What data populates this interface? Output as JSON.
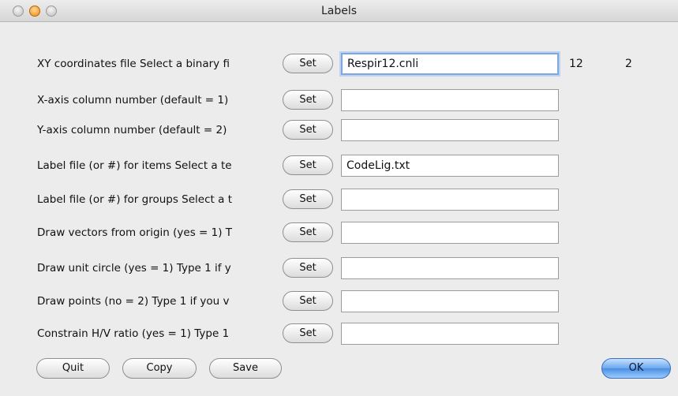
{
  "window": {
    "title": "Labels"
  },
  "rows": [
    {
      "label": "XY coordinates file Select a binary fi",
      "button": "Set",
      "value": "Respir12.cnli",
      "extra": [
        "12",
        "2"
      ]
    },
    {
      "label": "X-axis column number (default = 1)",
      "button": "Set",
      "value": ""
    },
    {
      "label": "Y-axis column number (default = 2)",
      "button": "Set",
      "value": ""
    },
    {
      "label": "Label file (or #) for items Select a te",
      "button": "Set",
      "value": "CodeLig.txt"
    },
    {
      "label": "Label file (or #) for groups Select a t",
      "button": "Set",
      "value": ""
    },
    {
      "label": "Draw vectors from origin (yes = 1) T",
      "button": "Set",
      "value": ""
    },
    {
      "label": "Draw unit circle (yes = 1) Type 1 if y",
      "button": "Set",
      "value": ""
    },
    {
      "label": "Draw points (no = 2) Type 1 if you v",
      "button": "Set",
      "value": ""
    },
    {
      "label": "Constrain H/V ratio (yes = 1) Type 1",
      "button": "Set",
      "value": ""
    }
  ],
  "footer": {
    "quit": "Quit",
    "copy": "Copy",
    "save": "Save",
    "ok": "OK"
  }
}
